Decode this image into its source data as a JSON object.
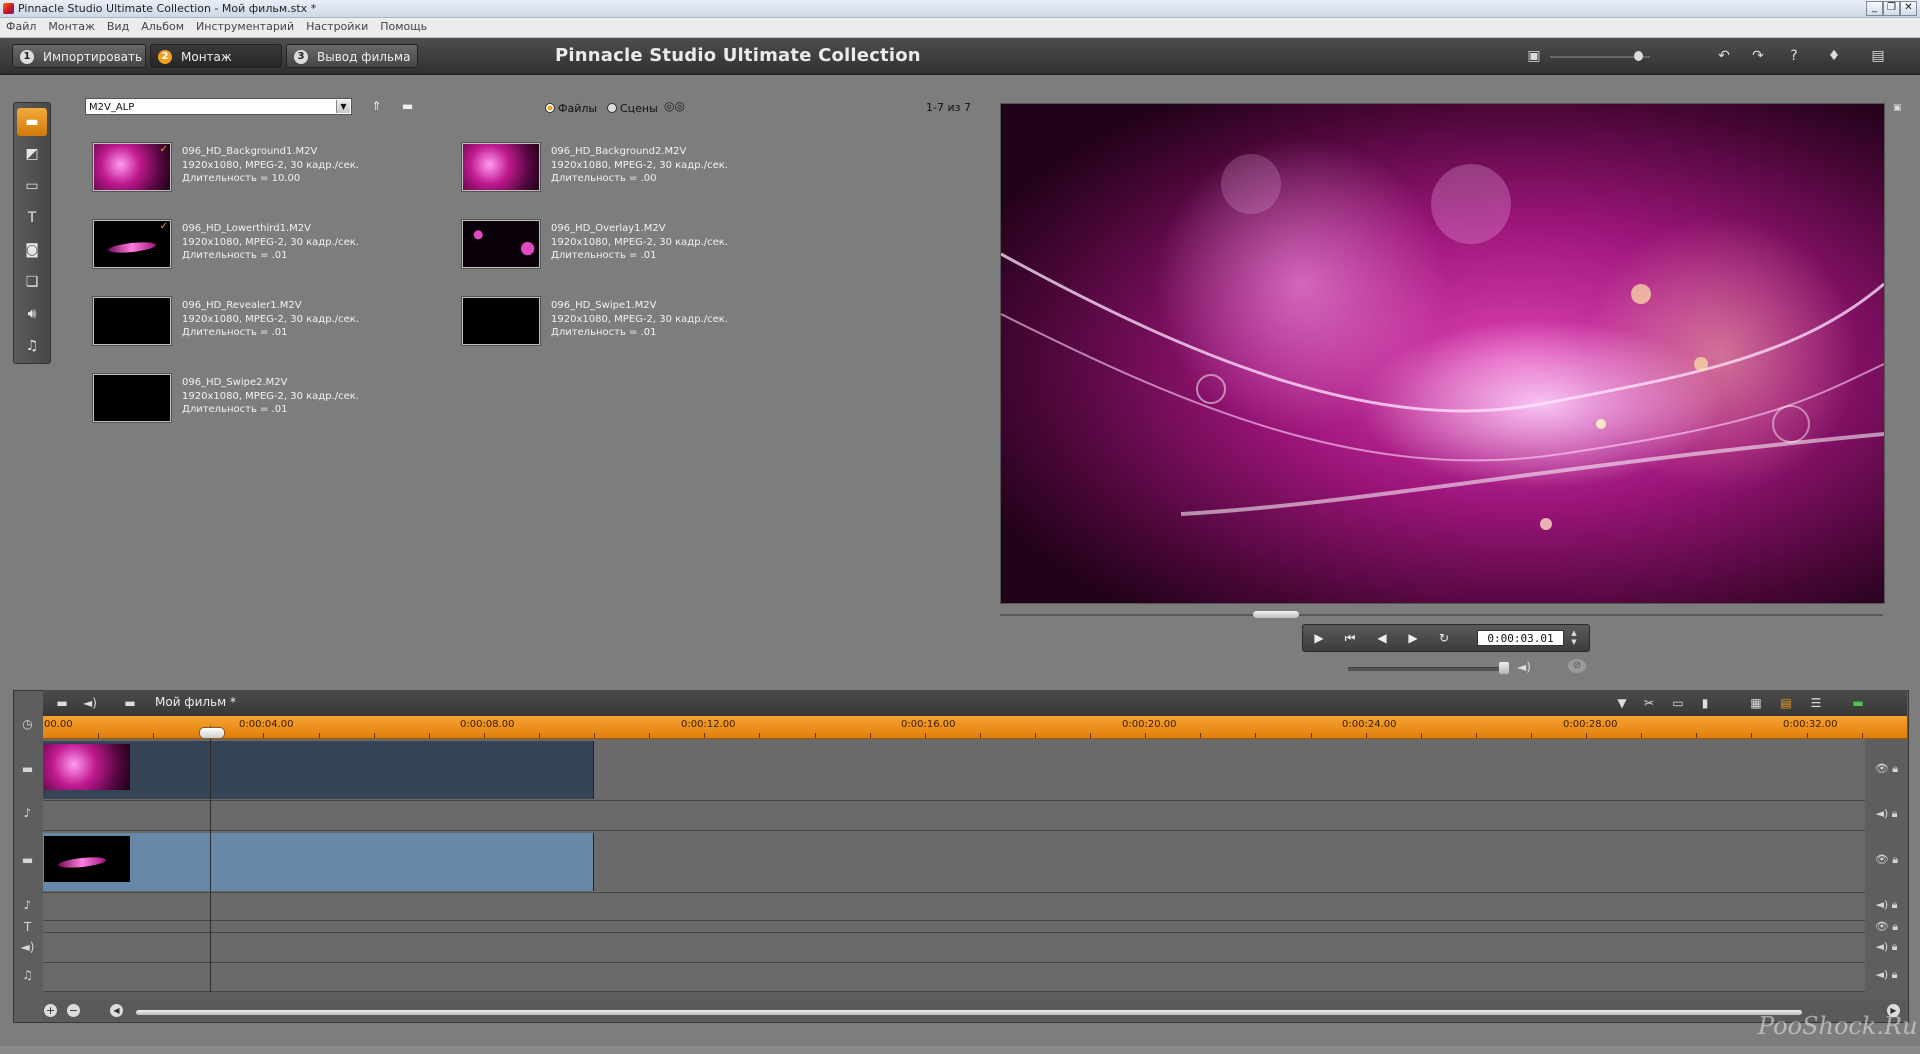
{
  "window": {
    "title": "Pinnacle Studio Ultimate Collection - Мой фильм.stx *",
    "controls": [
      "_",
      "❐",
      "✕"
    ]
  },
  "menu": [
    "Файл",
    "Монтаж",
    "Вид",
    "Альбом",
    "Инструментарий",
    "Настройки",
    "Помощь"
  ],
  "modes": [
    {
      "num": "1",
      "label": "Импортировать"
    },
    {
      "num": "2",
      "label": "Монтаж"
    },
    {
      "num": "3",
      "label": "Вывод фильма"
    }
  ],
  "app_title": "Pinnacle Studio Ultimate Collection",
  "album": {
    "selected": "M2V_ALP",
    "view_files": "Файлы",
    "view_scenes": "Сцены",
    "paging": "1-7 из 7"
  },
  "media": [
    {
      "name": "096_HD_Background1.M2V",
      "meta": "1920x1080, MPEG-2, 30 кадр./сек.",
      "duration": "Длительность = 10.00",
      "thumb": "pink",
      "checked": true
    },
    {
      "name": "096_HD_Background2.M2V",
      "meta": "1920x1080, MPEG-2, 30 кадр./сек.",
      "duration": "Длительность = .00",
      "thumb": "pink",
      "checked": false
    },
    {
      "name": "096_HD_Lowerthird1.M2V",
      "meta": "1920x1080, MPEG-2, 30 кадр./сек.",
      "duration": "Длительность = .01",
      "thumb": "lower",
      "checked": true
    },
    {
      "name": "096_HD_Overlay1.M2V",
      "meta": "1920x1080, MPEG-2, 30 кадр./сек.",
      "duration": "Длительность = .01",
      "thumb": "overlay",
      "checked": false
    },
    {
      "name": "096_HD_Revealer1.M2V",
      "meta": "1920x1080, MPEG-2, 30 кадр./сек.",
      "duration": "Длительность = .01",
      "thumb": "black",
      "checked": false
    },
    {
      "name": "096_HD_Swipe1.M2V",
      "meta": "1920x1080, MPEG-2, 30 кадр./сек.",
      "duration": "Длительность = .01",
      "thumb": "black",
      "checked": false
    },
    {
      "name": "096_HD_Swipe2.M2V",
      "meta": "1920x1080, MPEG-2, 30 кадр./сек.",
      "duration": "Длительность = .01",
      "thumb": "black",
      "checked": false
    }
  ],
  "player": {
    "timecode": "0:00:03.01"
  },
  "timeline": {
    "project_name": "Мой фильм *",
    "ruler_labels": [
      "00.00",
      "0:00:04.00",
      "0:00:08.00",
      "0:00:12.00",
      "0:00:16.00",
      "0:00:20.00",
      "0:00:24.00",
      "0:00:28.00",
      "0:00:32.00"
    ]
  },
  "watermark": "PooShock.Ru",
  "colors": {
    "accent": "#f0a020",
    "ruler": "#f29a27",
    "video_clip": "#364555",
    "overlay_clip": "#6888a8"
  }
}
